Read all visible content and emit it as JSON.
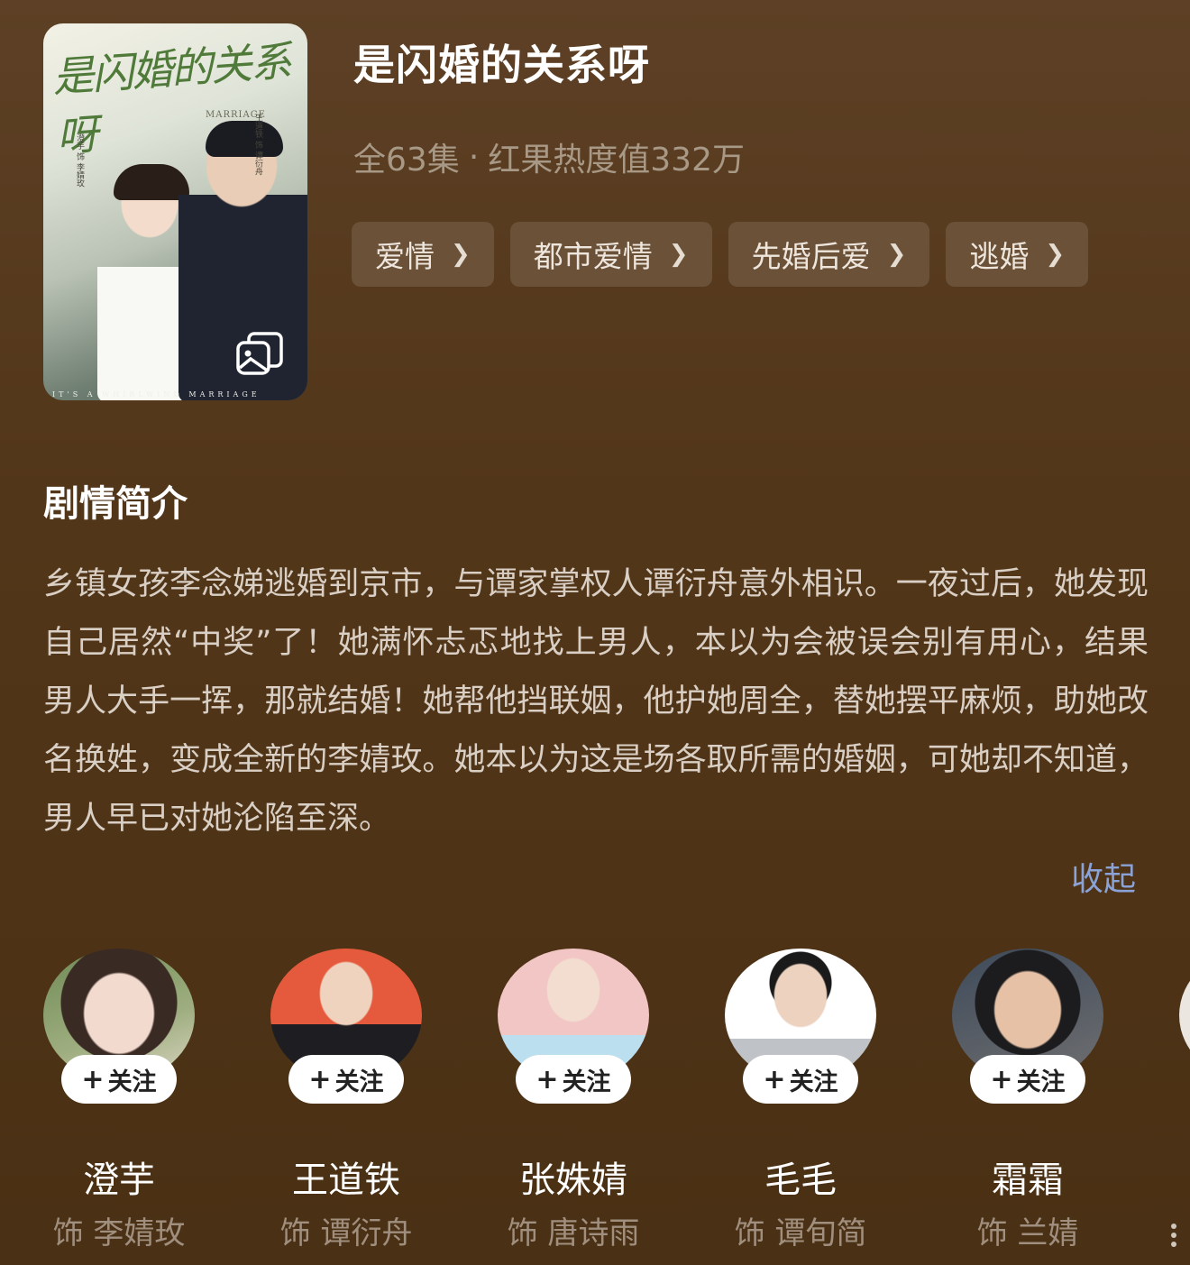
{
  "poster": {
    "calligraphy_title": "是闪婚的关系呀",
    "brand": "MARRIAGE",
    "credit_left": "澄芋 饰 李婧玫",
    "credit_right": "王道铁 饰 谭衍舟",
    "footer": "IT'S A WHIRLWIND MARRIAGE"
  },
  "drama": {
    "title": "是闪婚的关系呀",
    "episodes": "全63集",
    "separator": "·",
    "heat": "红果热度值332万"
  },
  "tags": [
    {
      "label": "爱情"
    },
    {
      "label": "都市爱情"
    },
    {
      "label": "先婚后爱"
    },
    {
      "label": "逃婚"
    }
  ],
  "synopsis": {
    "heading": "剧情简介",
    "text": "乡镇女孩李念娣逃婚到京市，与谭家掌权人谭衍舟意外相识。一夜过后，她发现自己居然“中奖”了！她满怀忐忑地找上男人，本以为会被误会别有用心，结果男人大手一挥，那就结婚！她帮他挡联姻，他护她周全，替她摆平麻烦，助她改名换姓，变成全新的李婧玫。她本以为这是场各取所需的婚姻，可她却不知道，男人早已对她沦陷至深。",
    "collapse_label": "收起"
  },
  "follow_label": "关注",
  "cast": [
    {
      "name": "澄芋",
      "role": "饰 李婧玫"
    },
    {
      "name": "王道铁",
      "role": "饰 谭衍舟"
    },
    {
      "name": "张姝婧",
      "role": "饰 唐诗雨"
    },
    {
      "name": "毛毛",
      "role": "饰 谭旬简"
    },
    {
      "name": "霜霜",
      "role": "饰 兰婧"
    }
  ],
  "icons": {
    "gallery": "gallery-icon",
    "chevron": "chevron-right-icon",
    "plus": "plus-icon"
  },
  "colors": {
    "background": "#523619",
    "tag_bg": "#6a5138",
    "link": "#8aa2d6",
    "muted": "#a89886"
  }
}
